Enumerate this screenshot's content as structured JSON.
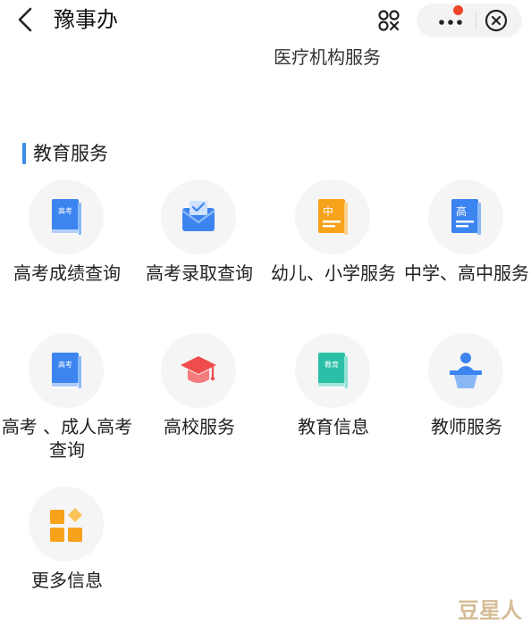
{
  "header": {
    "title": "豫事办"
  },
  "previous_section_last_item": "医疗机构服务",
  "section": {
    "title": "教育服务",
    "items": [
      {
        "label": "高考成绩查询",
        "icon": "gaokao-book-icon",
        "icon_text": "高考"
      },
      {
        "label": "高考录取查询",
        "icon": "mail-check-icon"
      },
      {
        "label": "幼儿、小学服务",
        "icon": "primary-school-book-icon",
        "icon_text": "中"
      },
      {
        "label": "中学、高中服务",
        "icon": "high-school-book-icon",
        "icon_text": "高"
      },
      {
        "label": "高考 、成人高考查询",
        "icon": "adult-exam-book-icon",
        "icon_text": "高考"
      },
      {
        "label": "高校服务",
        "icon": "graduation-cap-icon"
      },
      {
        "label": "教育信息",
        "icon": "education-info-book-icon",
        "icon_text": "教育"
      },
      {
        "label": "教师服务",
        "icon": "teacher-podium-icon"
      },
      {
        "label": "更多信息",
        "icon": "grid-more-icon"
      }
    ]
  },
  "watermark": "豆星人",
  "colors": {
    "section_bar": "#3a8ee6",
    "blue_icon": "#3c84f0",
    "orange_icon": "#f7a21b",
    "teal_icon": "#2bbfa8",
    "red_icon": "#ef4c4c",
    "notify_dot": "#f0452b"
  }
}
